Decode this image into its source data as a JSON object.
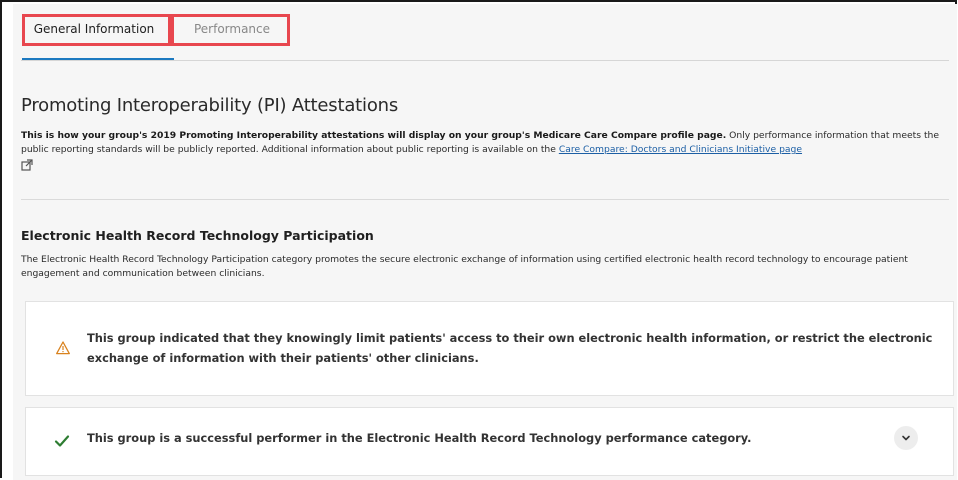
{
  "tabs": [
    {
      "label": "General Information",
      "active": true
    },
    {
      "label": "Performance",
      "active": false
    }
  ],
  "section": {
    "title": "Promoting Interoperability (PI) Attestations",
    "intro_bold": "This is how your group's 2019 Promoting Interoperability attestations will display on your group's Medicare Care Compare profile page.",
    "intro_text": " Only performance information that meets the public reporting standards will be publicly reported. Additional information about public reporting is available on the ",
    "intro_link": "Care Compare: Doctors and Clinicians Initiative page",
    "link_icon": "external-link-icon"
  },
  "ehr": {
    "title": "Electronic Health Record Technology Participation",
    "description": "The Electronic Health Record Technology Participation category promotes the secure electronic exchange of information using certified electronic health record technology to encourage patient engagement and communication between clinicians."
  },
  "alerts": {
    "warning": {
      "icon": "warning-triangle-icon",
      "text": "This group indicated that they knowingly limit patients' access to their own electronic health information, or restrict the electronic exchange of information with their patients' other clinicians."
    },
    "success": {
      "icon": "checkmark-icon",
      "text": "This group is a successful performer in the Electronic Health Record Technology performance category.",
      "expand_icon": "chevron-down-icon"
    }
  },
  "colors": {
    "accent": "#1c79c0",
    "highlight": "#e8474f",
    "warning": "#d9821e",
    "success": "#2e7d32",
    "link": "#1c5fa5"
  }
}
